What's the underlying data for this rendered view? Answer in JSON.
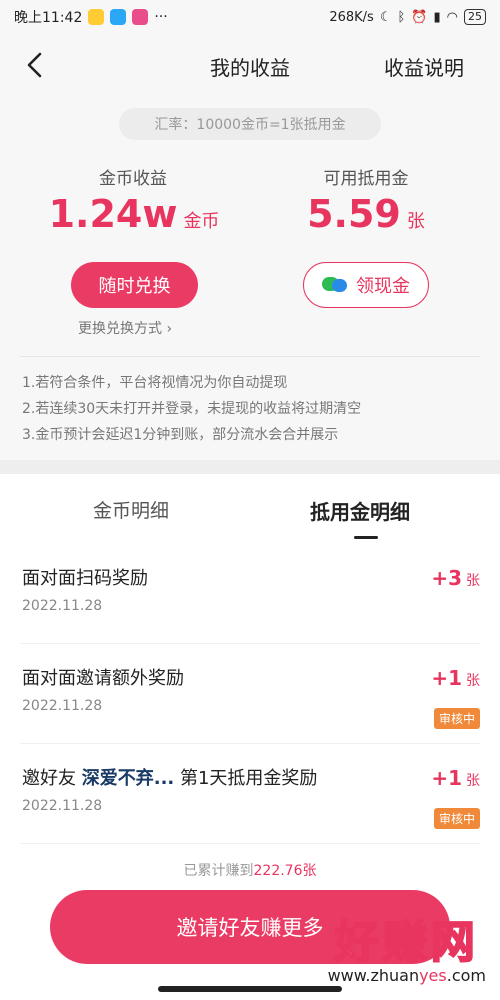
{
  "status": {
    "time": "晚上11:42",
    "right_text": "268K/s",
    "battery": "25"
  },
  "header": {
    "title": "我的收益",
    "explain": "收益说明"
  },
  "summary": {
    "rate": "汇率：10000金币=1张抵用金",
    "coins_title": "金币收益",
    "coins_value": "1.24w",
    "coins_unit": "金币",
    "voucher_title": "可用抵用金",
    "voucher_value": "5.59",
    "voucher_unit": "张",
    "exchange_button": "随时兑换",
    "withdraw_button": "领现金",
    "change_method": "更换兑换方式 ›",
    "notes": [
      "1.若符合条件，平台将视情况为你自动提现",
      "2.若连续30天未打开并登录，未提现的收益将过期清空",
      "3.金币预计会延迟1分钟到账，部分流水会合并展示"
    ]
  },
  "tabs": {
    "coins": "金币明细",
    "voucher": "抵用金明细"
  },
  "records": [
    {
      "title": "面对面扫码奖励",
      "date": "2022.11.28",
      "amount": "+3",
      "unit": "张",
      "badge": ""
    },
    {
      "title": "面对面邀请额外奖励",
      "date": "2022.11.28",
      "amount": "+1",
      "unit": "张",
      "badge": "审核中"
    },
    {
      "title_prefix": "邀好友",
      "highlight": "深爱不弃...",
      "title_suffix": "第1天抵用金奖励",
      "date": "2022.11.28",
      "amount": "+1",
      "unit": "张",
      "badge": "审核中"
    }
  ],
  "footer": {
    "total_prefix": "已累计赚到",
    "total_value": "222.76张",
    "invite_button": "邀请好友赚更多"
  },
  "watermark": {
    "logo": "好赚网",
    "url_a": "www.zhuan",
    "url_b": "yes",
    "url_c": ".com"
  },
  "colors": {
    "accent": "#e8355f",
    "badge": "#f08a3a"
  }
}
